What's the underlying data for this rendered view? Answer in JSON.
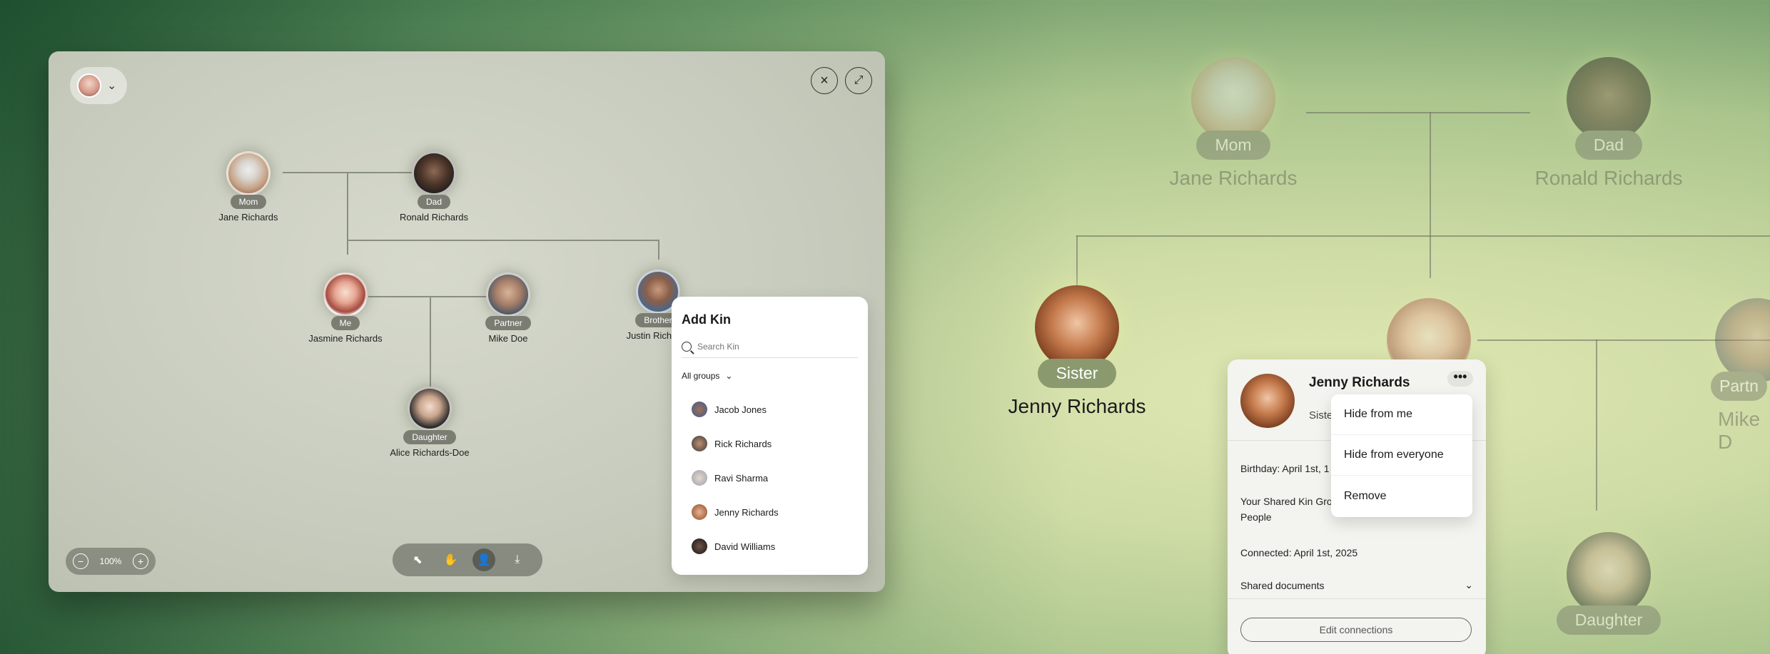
{
  "window": {
    "close_icon": "close-icon",
    "expand_icon": "expand-icon",
    "nodes": {
      "mom": {
        "role": "Mom",
        "name": "Jane Richards"
      },
      "dad": {
        "role": "Dad",
        "name": "Ronald Richards"
      },
      "me": {
        "role": "Me",
        "name": "Jasmine Richards"
      },
      "partner": {
        "role": "Partner",
        "name": "Mike Doe"
      },
      "brother": {
        "role": "Brother",
        "name": "Justin Richards"
      },
      "daughter": {
        "role": "Daughter",
        "name": "Alice Richards-Doe"
      }
    },
    "zoom": {
      "level": "100%"
    },
    "add_kin": {
      "title": "Add Kin",
      "search_placeholder": "Search Kin",
      "groups_label": "All groups",
      "items": [
        "Jacob Jones",
        "Rick Richards",
        "Ravi Sharma",
        "Jenny Richards",
        "David Williams"
      ]
    }
  },
  "scene": {
    "mom": {
      "role": "Mom",
      "name": "Jane Richards"
    },
    "dad": {
      "role": "Dad",
      "name": "Ronald Richards"
    },
    "sister": {
      "role": "Sister",
      "name": "Jenny Richards"
    },
    "partner_partial": {
      "role": "Partn",
      "name": "Mike D"
    },
    "daughter": {
      "role": "Daughter"
    },
    "me_partial_name": "ds"
  },
  "card": {
    "name": "Jenny Richards",
    "relation": "Siste",
    "birthday": "Birthday: April 1st, 1",
    "shared_group_a": "Your Shared Kin Gro",
    "shared_group_b": "People",
    "connected": "Connected: April 1st, 2025",
    "shared_documents": "Shared documents",
    "edit_label": "Edit connections",
    "more": "•••"
  },
  "menu": {
    "items": [
      "Hide from me",
      "Hide from everyone",
      "Remove"
    ]
  }
}
